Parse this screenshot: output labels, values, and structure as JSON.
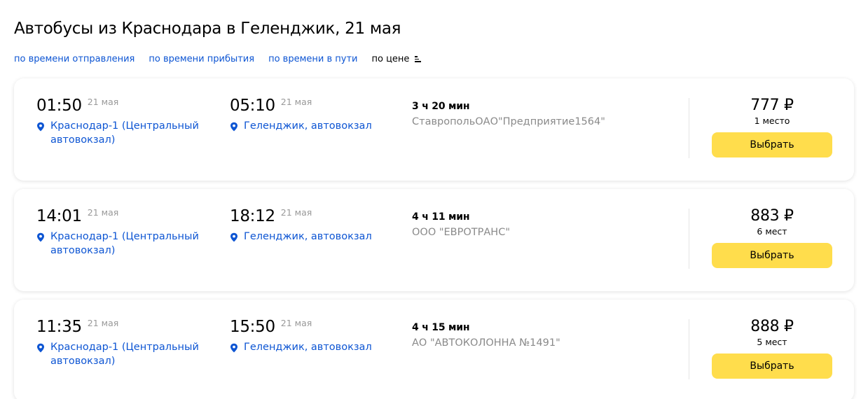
{
  "page": {
    "title": "Автобусы из Краснодара в Геленджик, 21 мая"
  },
  "sort": {
    "by_departure": "по времени отправления",
    "by_arrival": "по времени прибытия",
    "by_duration": "по времени в пути",
    "by_price": "по цене",
    "active": "by_price",
    "icon": "sort-ascending-icon"
  },
  "colors": {
    "link": "#0d55d3",
    "button": "#ffdd4c",
    "muted": "#8a8a8a"
  },
  "trips": [
    {
      "departure": {
        "time": "01:50",
        "date": "21 мая",
        "station": "Краснодар-1 (Центральный автовокзал)"
      },
      "arrival": {
        "time": "05:10",
        "date": "21 мая",
        "station": "Геленджик, автовокзал"
      },
      "duration": "3 ч 20 мин",
      "carrier": "СтавропольОАО\"Предприятие1564\"",
      "price": "777 ₽",
      "seats": "1 место",
      "button": "Выбрать"
    },
    {
      "departure": {
        "time": "14:01",
        "date": "21 мая",
        "station": "Краснодар-1 (Центральный автовокзал)"
      },
      "arrival": {
        "time": "18:12",
        "date": "21 мая",
        "station": "Геленджик, автовокзал"
      },
      "duration": "4 ч 11 мин",
      "carrier": "ООО \"ЕВРОТРАНС\"",
      "price": "883 ₽",
      "seats": "6 мест",
      "button": "Выбрать"
    },
    {
      "departure": {
        "time": "11:35",
        "date": "21 мая",
        "station": "Краснодар-1 (Центральный автовокзал)"
      },
      "arrival": {
        "time": "15:50",
        "date": "21 мая",
        "station": "Геленджик, автовокзал"
      },
      "duration": "4 ч 15 мин",
      "carrier": "АО \"АВТОКОЛОННА №1491\"",
      "price": "888 ₽",
      "seats": "5 мест",
      "button": "Выбрать"
    }
  ]
}
